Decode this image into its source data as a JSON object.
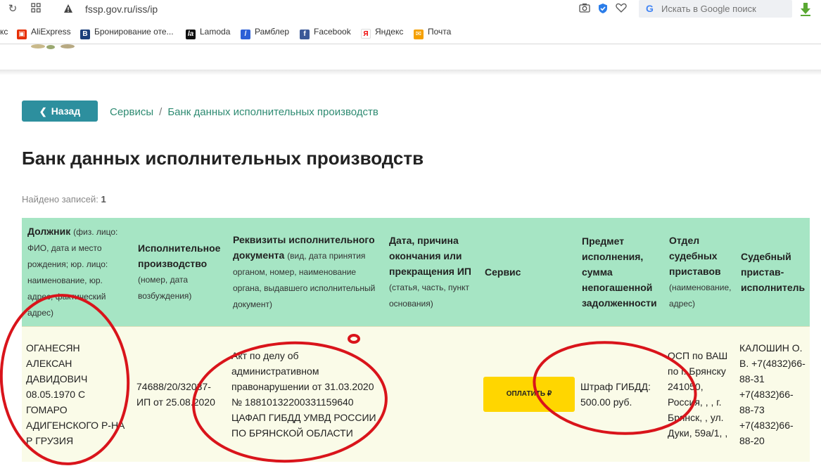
{
  "browser": {
    "url": "fssp.gov.ru/iss/ip",
    "search_placeholder": "Искать в Google поиск",
    "bookmarks": [
      {
        "label": "кс",
        "icon": ""
      },
      {
        "label": "AliExpress",
        "icon": "aliexpress-icon"
      },
      {
        "label": "Бронирование оте...",
        "icon": "booking-icon"
      },
      {
        "label": "Lamoda",
        "icon": "lamoda-icon"
      },
      {
        "label": "Рамблер",
        "icon": "rambler-icon"
      },
      {
        "label": "Facebook",
        "icon": "facebook-icon"
      },
      {
        "label": "Яндекс",
        "icon": "yandex-icon"
      },
      {
        "label": "Почта",
        "icon": "mail-icon"
      }
    ]
  },
  "nav": {
    "back_label": "Назад",
    "breadcrumb": [
      "Сервисы",
      "Банк данных исполнительных производств"
    ]
  },
  "page": {
    "title": "Банк данных исполнительных производств",
    "found_label": "Найдено записей:",
    "found_count": "1"
  },
  "table": {
    "headers": [
      {
        "title": "Должник",
        "sub": "(физ. лицо: ФИО, дата и место рождения; юр. лицо: наименование, юр. адрес, фактический адрес)"
      },
      {
        "title": "Исполнительное производство",
        "sub": "(номер, дата возбуждения)"
      },
      {
        "title": "Реквизиты исполнительного документа",
        "sub": "(вид, дата принятия органом, номер, наименование органа, выдавшего исполнительный документ)"
      },
      {
        "title": "Дата, причина окончания или прекращения ИП",
        "sub": "(статья, часть, пункт основания)"
      },
      {
        "title": "Сервис",
        "sub": ""
      },
      {
        "title": "Предмет исполнения, сумма непогашенной задолженности",
        "sub": ""
      },
      {
        "title": "Отдел судебных приставов",
        "sub": "(наименование, адрес)"
      },
      {
        "title": "Судебный пристав-исполнитель",
        "sub": ""
      }
    ],
    "row": {
      "debtor": "ОГАНЕСЯН АЛЕКСАН ДАВИДОВИЧ 08.05.1970 С ГОМАРО АДИГЕНСКОГО Р-НА Р ГРУЗИЯ",
      "proceeding": "74688/20/32037-ИП от 25.08.2020",
      "document": "Акт по делу об административном правонарушении от 31.03.2020 № 18810132200331159640 ЦАФАП ГИБДД УМВД РОССИИ ПО БРЯНСКОЙ ОБЛАСТИ",
      "end_date": "",
      "pay_label": "ОПЛАТИТЬ ₽",
      "subject": "Штраф ГИБДД: 500.00 руб.",
      "department": "ОСП по ВАШ по г. Брянску 241050, Россия, , , г. Брянск, , ул. Дуки, 59а/1, ,",
      "bailiff": "КАЛОШИН О. В. +7(4832)66-88-31 +7(4832)66-88-73 +7(4832)66-88-20"
    }
  },
  "colors": {
    "accent": "#2d8f9e",
    "header_bg": "#a6e5c4",
    "row_bg": "#fafbe8",
    "pay_button": "#ffd600",
    "annotation": "#d9141b"
  }
}
